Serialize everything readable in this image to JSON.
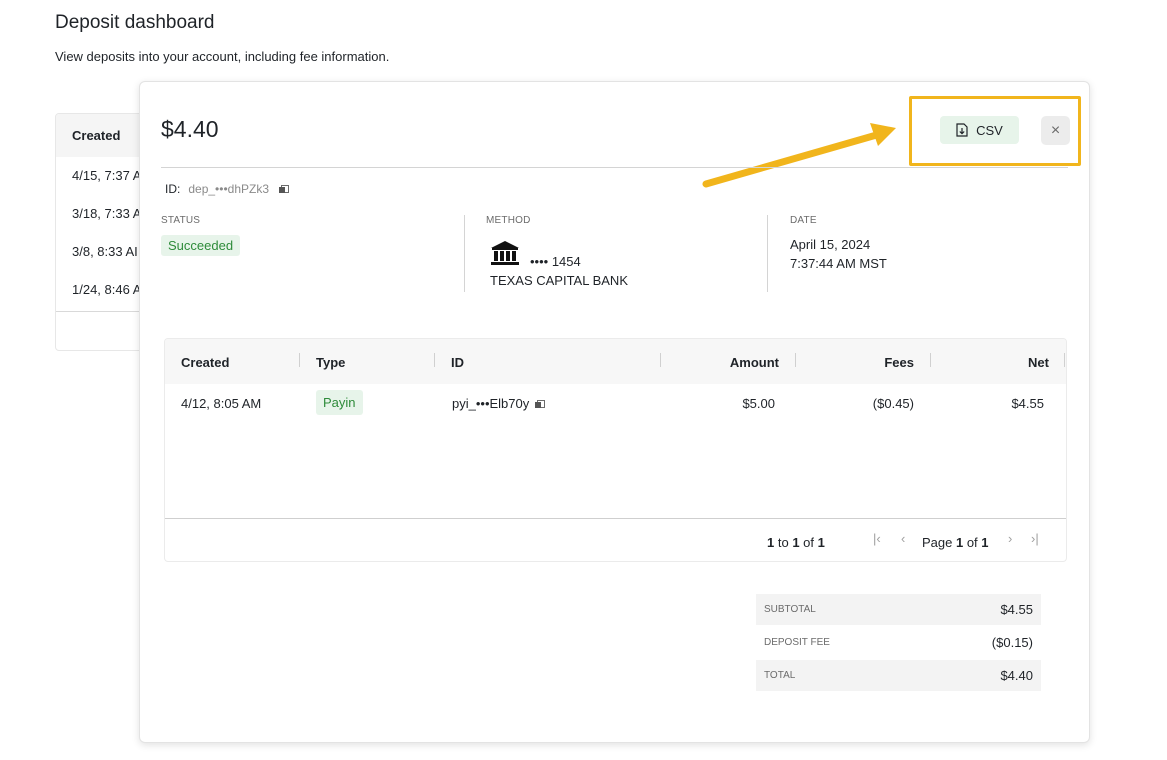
{
  "page": {
    "title": "Deposit dashboard",
    "subtitle": "View deposits into your account, including fee information."
  },
  "background_table": {
    "header": "Created",
    "rows": [
      "4/15, 7:37 A",
      "3/18, 7:33 A",
      "3/8, 8:33 AI",
      "1/24, 8:46 A"
    ]
  },
  "modal": {
    "amount": "$4.40",
    "csv_label": "CSV",
    "close_icon": "×",
    "id_label": "ID:",
    "id_value": "dep_•••dhPZk3",
    "status": {
      "label": "STATUS",
      "value": "Succeeded"
    },
    "method": {
      "label": "METHOD",
      "mask": "•••• 1454",
      "bank": "TEXAS CAPITAL BANK",
      "icon": "bank-icon"
    },
    "date": {
      "label": "DATE",
      "date": "April 15, 2024",
      "time": "7:37:44 AM MST"
    }
  },
  "transactions": {
    "columns": [
      "Created",
      "Type",
      "ID",
      "Amount",
      "Fees",
      "Net"
    ],
    "rows": [
      {
        "created": "4/12, 8:05 AM",
        "type": "Payin",
        "id": "pyi_•••Elb70y",
        "amount": "$5.00",
        "fees": "($0.45)",
        "net": "$4.55"
      }
    ],
    "pager": {
      "count_pre": "1",
      "count_to": " to ",
      "count_mid": "1",
      "count_of": " of ",
      "count_total": "1",
      "page_label": "Page ",
      "page_num": "1",
      "page_of": " of ",
      "page_total": "1",
      "first": "|‹",
      "prev": "‹",
      "next": "›",
      "last": "›|"
    }
  },
  "summary": {
    "subtotal": {
      "label": "SUBTOTAL",
      "value": "$4.55"
    },
    "fee": {
      "label": "DEPOSIT FEE",
      "value": "($0.15)"
    },
    "total": {
      "label": "TOTAL",
      "value": "$4.40"
    }
  },
  "colors": {
    "accent_green": "#2e8b3a",
    "badge_bg": "#e7f4ea",
    "highlight": "#f1b51c"
  }
}
